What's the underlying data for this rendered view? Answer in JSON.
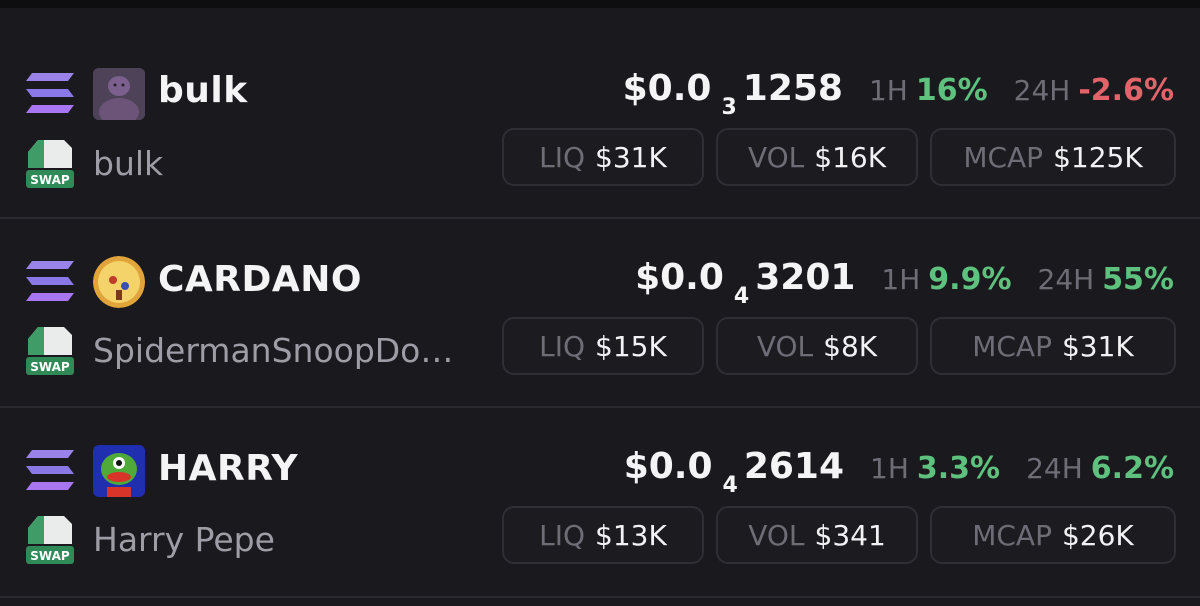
{
  "tokens": [
    {
      "symbol": "bulk",
      "name": "bulk",
      "price_prefix": "$0.0",
      "price_zeros": "3",
      "price_digits": "1258",
      "h1_label": "1H",
      "h1_change": "16%",
      "h24_label": "24H",
      "h24_change": "-2.6%",
      "liq_label": "LIQ",
      "liq": "$31K",
      "vol_label": "VOL",
      "vol": "$16K",
      "mcap_label": "MCAP",
      "mcap": "$125K"
    },
    {
      "symbol": "CARDANO",
      "name": "SpidermanSnoopDo…",
      "price_prefix": "$0.0",
      "price_zeros": "4",
      "price_digits": "3201",
      "h1_label": "1H",
      "h1_change": "9.9%",
      "h24_label": "24H",
      "h24_change": "55%",
      "liq_label": "LIQ",
      "liq": "$15K",
      "vol_label": "VOL",
      "vol": "$8K",
      "mcap_label": "MCAP",
      "mcap": "$31K"
    },
    {
      "symbol": "HARRY",
      "name": "Harry Pepe",
      "price_prefix": "$0.0",
      "price_zeros": "4",
      "price_digits": "2614",
      "h1_label": "1H",
      "h1_change": "3.3%",
      "h24_label": "24H",
      "h24_change": "6.2%",
      "liq_label": "LIQ",
      "liq": "$13K",
      "vol_label": "VOL",
      "vol": "$341",
      "mcap_label": "MCAP",
      "mcap": "$26K"
    }
  ],
  "dex_badge": "SWAP",
  "icons": {
    "chain": "solana-icon",
    "dex": "swap-dex-icon"
  },
  "colors": {
    "positive": "#5ec17e",
    "negative": "#e0646a",
    "background": "#1a191e"
  }
}
